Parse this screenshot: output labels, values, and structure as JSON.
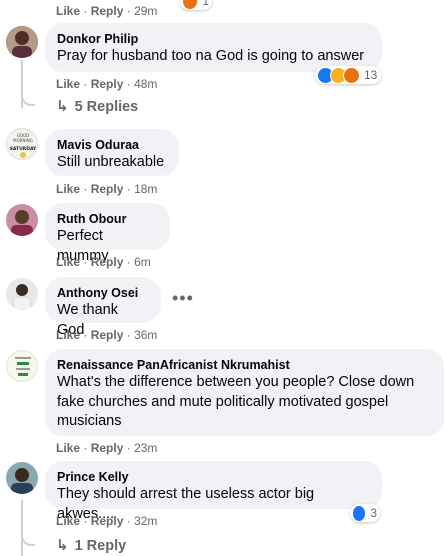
{
  "top_partial": {
    "like": "Like",
    "reply": "Reply",
    "time": "29m",
    "reaction_count": "1"
  },
  "comments": [
    {
      "author": "Donkor Philip",
      "text": "Pray for husband too na God is going to answer",
      "like": "Like",
      "reply": "Reply",
      "time": "48m",
      "reaction_count": "13",
      "replies_label": "5 Replies"
    },
    {
      "author": "Mavis Oduraa",
      "text": "Still unbreakable",
      "like": "Like",
      "reply": "Reply",
      "time": "18m",
      "avatar_text": [
        "GOOD",
        "MORNING",
        "SATURDAY"
      ]
    },
    {
      "author": "Ruth Obour",
      "text": "Perfect mummy",
      "like": "Like",
      "reply": "Reply",
      "time": "6m"
    },
    {
      "author": "Anthony Osei",
      "text": "We thank God",
      "like": "Like",
      "reply": "Reply",
      "time": "36m"
    },
    {
      "author": "Renaissance PanAfricanist Nkrumahist",
      "text_lines": [
        "What's the difference between you people? Close down",
        "fake churches and mute politically motivated gospel",
        "musicians"
      ],
      "like": "Like",
      "reply": "Reply",
      "time": "23m"
    },
    {
      "author": "Prince Kelly",
      "text": "They should arrest the useless actor big akwes....",
      "like": "Like",
      "reply": "Reply",
      "time": "32m",
      "reaction_count": "3",
      "replies_label": "1 Reply"
    }
  ],
  "icons": [
    "like-reaction-icon",
    "haha-reaction-icon",
    "angry-reaction-icon",
    "reply-arrow-icon",
    "more-options-icon"
  ],
  "colors": {
    "bubble": "#f0f2f5",
    "secondary_text": "#65676b",
    "like_blue": "#1877f2",
    "thread_line": "#ced0d4"
  }
}
